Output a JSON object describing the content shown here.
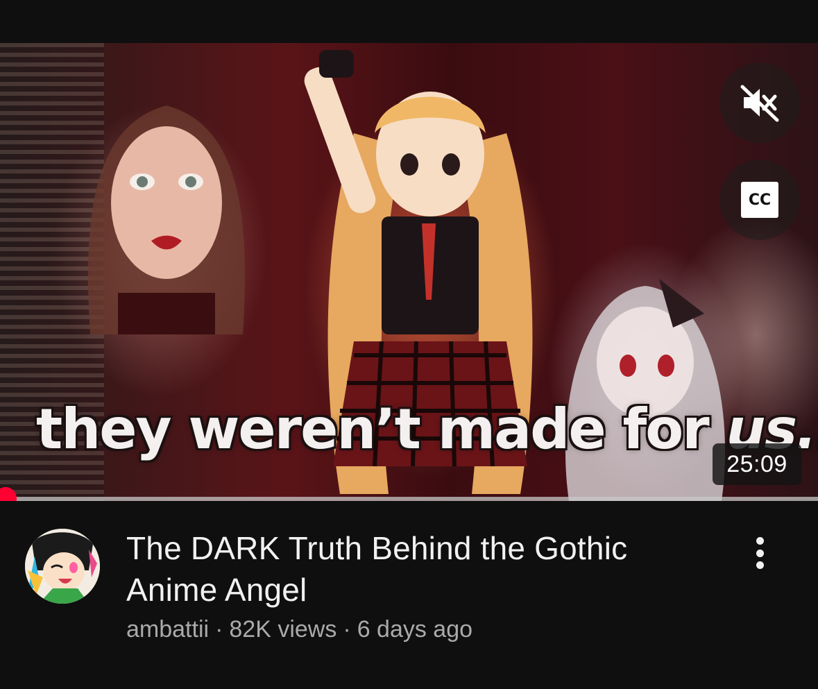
{
  "video": {
    "caption_overlay_main": "they weren’t made for ",
    "caption_overlay_emph": "us...",
    "duration": "25:09",
    "cc_label": "CC",
    "progress_fraction": 0.004,
    "title": "The DARK Truth Behind the Gothic Anime Angel",
    "channel": "ambattii",
    "separator": "·",
    "views": "82K views",
    "age": "6 days ago"
  },
  "icons": {
    "mute": "muted-speaker-icon",
    "cc": "closed-captions-icon",
    "more": "more-vertical-icon"
  },
  "colors": {
    "background": "#0f0f0f",
    "progress_red": "#ff0033",
    "title_text": "#f1f1f1",
    "meta_text": "#aaaaaa"
  }
}
